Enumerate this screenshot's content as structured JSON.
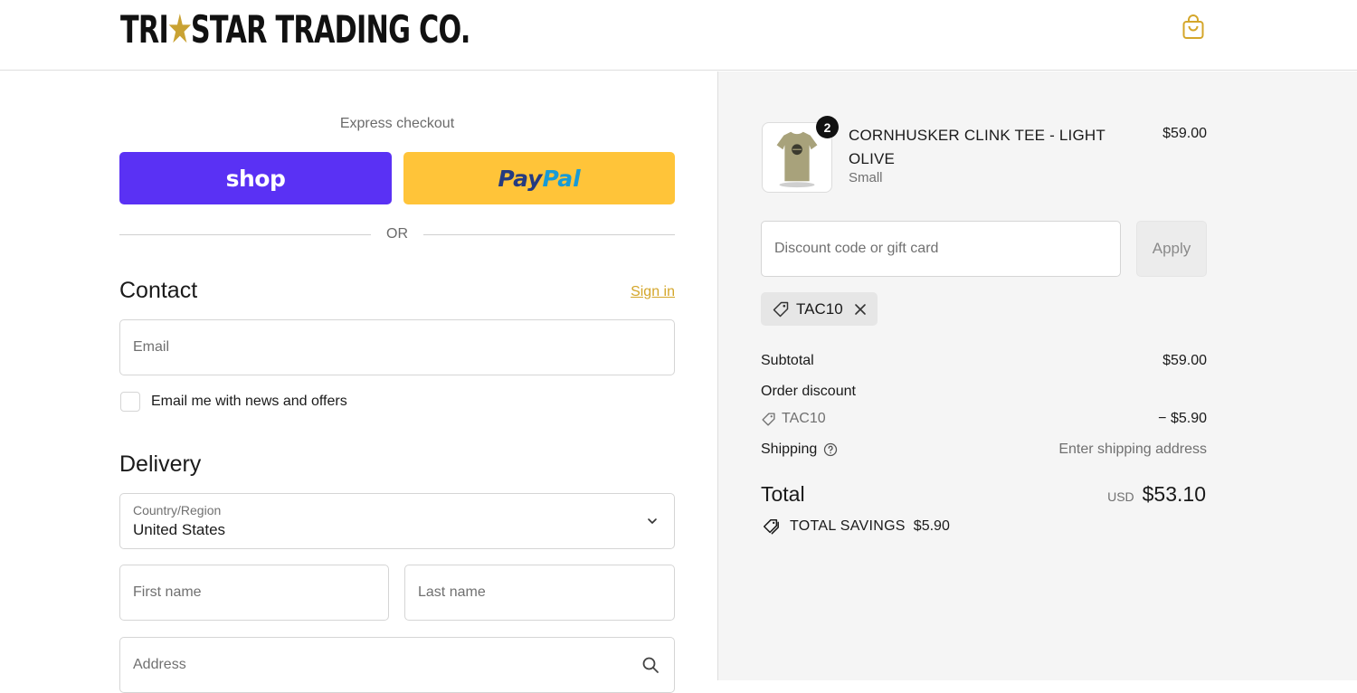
{
  "header": {
    "logo_left": "TRI",
    "logo_star": "★",
    "logo_right": "STAR TRADING CO.",
    "cart_icon": "shopping-bag-icon"
  },
  "express": {
    "label": "Express checkout",
    "shop_label": "shop",
    "paypal_part1": "Pay",
    "paypal_part2": "Pal",
    "or_label": "OR"
  },
  "contact": {
    "title": "Contact",
    "signin_label": "Sign in",
    "email_placeholder": "Email",
    "newsletter_label": "Email me with news and offers",
    "newsletter_checked": false
  },
  "delivery": {
    "title": "Delivery",
    "country_label": "Country/Region",
    "country_value": "United States",
    "first_name_placeholder": "First name",
    "last_name_placeholder": "Last name",
    "address_placeholder": "Address"
  },
  "summary": {
    "product": {
      "name": "CORNHUSKER CLINK TEE - LIGHT OLIVE",
      "variant": "Small",
      "price": "$59.00",
      "quantity": "2"
    },
    "discount_placeholder": "Discount code or gift card",
    "apply_label": "Apply",
    "applied_code": "TAC10",
    "subtotal_label": "Subtotal",
    "subtotal_value": "$59.00",
    "order_discount_label": "Order discount",
    "discount_code": "TAC10",
    "discount_value": "− $5.90",
    "shipping_label": "Shipping",
    "shipping_value": "Enter shipping address",
    "total_label": "Total",
    "total_currency": "USD",
    "total_value": "$53.10",
    "savings_label": "TOTAL SAVINGS",
    "savings_value": "$5.90"
  },
  "colors": {
    "shop_purple": "#5a31f4",
    "paypal_yellow": "#ffc439",
    "accent_gold": "#d4a62a"
  }
}
